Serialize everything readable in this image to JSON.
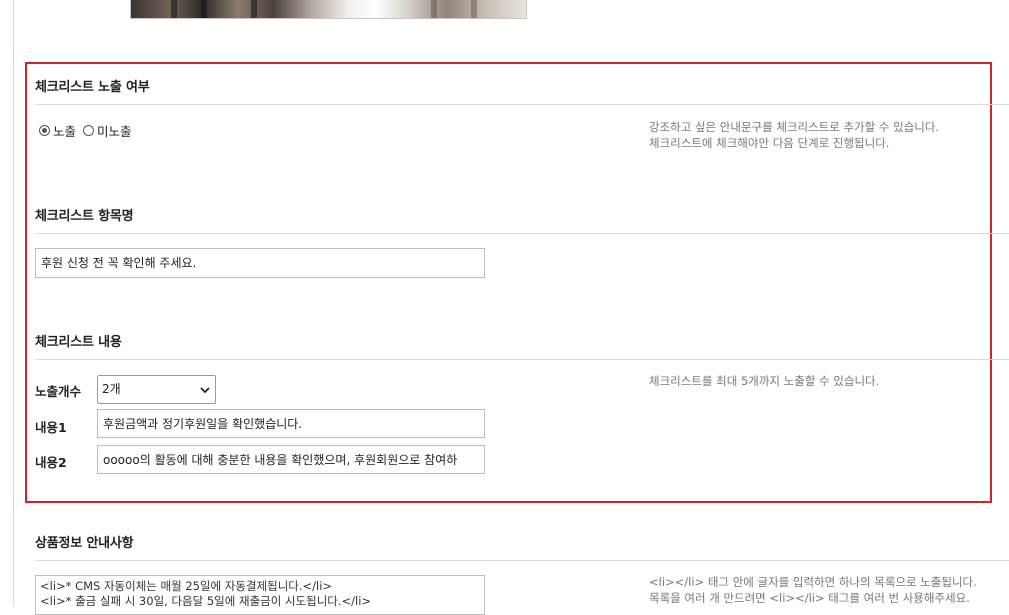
{
  "checklist_exposure": {
    "title": "체크리스트 노출 여부",
    "options": [
      {
        "label": "노출",
        "checked": true
      },
      {
        "label": "미노출",
        "checked": false
      }
    ],
    "help_lines": [
      "강조하고 싶은 안내문구를 체크리스트로 추가할 수 있습니다.",
      "체크리스트에 체크해야만 다음 단계로 진행됩니다."
    ]
  },
  "checklist_item_name": {
    "title": "체크리스트 항목명",
    "value": "후원 신청 전 꼭 확인해 주세요."
  },
  "checklist_content": {
    "title": "체크리스트 내용",
    "count_label": "노출개수",
    "count_value": "2개",
    "help": "체크리스트를 최대 5개까지 노출할 수 있습니다.",
    "items": [
      {
        "label": "내용1",
        "value": "후원금액과 정기후원일을 확인했습니다."
      },
      {
        "label": "내용2",
        "value": "ooooo의 활동에 대해 충분한 내용을 확인했으며, 후원회원으로 참여하"
      }
    ]
  },
  "product_info": {
    "title": "상품정보 안내사항",
    "textarea_lines": [
      "<li>* CMS 자동이체는 매월 25일에 자동결제됩니다.</li>",
      "<li>* 출금 실패 시 30일, 다음달 5일에 재출금이 시도됩니다.</li>"
    ],
    "help_lines": [
      "<li></li> 태그 안에 글자를 입력하면 하나의 목록으로 노출됩니다.",
      "목록을 여러 개 만드려면 <li></li> 태그를 여러 번 사용해주세요."
    ]
  },
  "colors": {
    "highlight_border": "#d6202b"
  },
  "icons": {
    "select_arrow": "chevron-down-icon"
  }
}
